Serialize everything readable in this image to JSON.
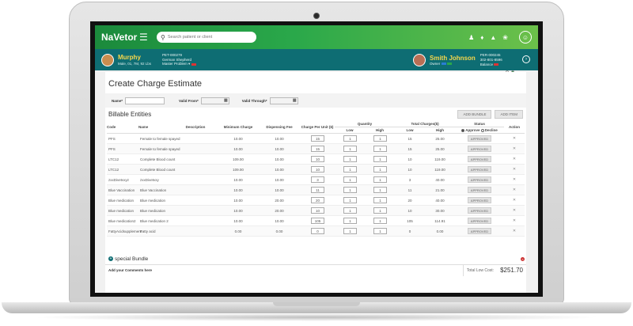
{
  "app": {
    "brand": "NaVetor",
    "search_placeholder": "Search patient or client"
  },
  "patient": {
    "name": "Murphy",
    "meta": "Male, 01, 7M, 92 Lbs",
    "id": "PET-000279",
    "breed": "German Shepherd",
    "problem": "Master Problem ▾"
  },
  "owner": {
    "name": "Smith Johnson",
    "tag": "Owner",
    "id": "PER-000245",
    "phone": "302-801-8596",
    "balance": "Balance"
  },
  "page": {
    "title": "Create Charge Estimate",
    "filters": {
      "name_label": "Name*",
      "valid_from_label": "Valid From*",
      "valid_through_label": "Valid Through*"
    },
    "section_title": "Billable Entities",
    "add_bundle": "ADD BUNDLE",
    "add_item": "ADD ITEM"
  },
  "table": {
    "headers": {
      "code": "Code",
      "name": "Name",
      "description": "Description",
      "min_charge": "Minimum Charge",
      "dispensing_fee": "Dispensing Fee",
      "charge_per_unit": "Charge Per Unit ($)",
      "quantity": "Quantity",
      "low": "Low",
      "high": "High",
      "total_charges": "Total Charges($)",
      "total_low": "Low",
      "total_high": "High",
      "status": "Status",
      "approve": "Approve",
      "decline": "Decline",
      "action": "Action"
    },
    "status_label": "APPROVED",
    "rows": [
      {
        "code": "PFS",
        "name": "",
        "description": "Female to female spayed",
        "min_charge": "10.00",
        "dispensing_fee": "10.00",
        "charge_per_unit": "15",
        "q_low": "1",
        "q_high": "1",
        "t_low": "15",
        "t_high": "25.00"
      },
      {
        "code": "PFS",
        "name": "",
        "description": "Female to female spayed",
        "min_charge": "10.00",
        "dispensing_fee": "10.00",
        "charge_per_unit": "15",
        "q_low": "1",
        "q_high": "1",
        "t_low": "15",
        "t_high": "25.00"
      },
      {
        "code": "LTC12",
        "name": "",
        "description": "Complete Blood count",
        "min_charge": "109.00",
        "dispensing_fee": "10.00",
        "charge_per_unit": "10",
        "q_low": "1",
        "q_high": "1",
        "t_low": "10",
        "t_high": "119.00"
      },
      {
        "code": "LTC12",
        "name": "",
        "description": "Complete Blood count",
        "min_charge": "109.00",
        "dispensing_fee": "10.00",
        "charge_per_unit": "10",
        "q_low": "1",
        "q_high": "1",
        "t_low": "10",
        "t_high": "119.00"
      },
      {
        "code": "zxxDivetvxyz",
        "name": "",
        "description": "zxxDivetvxy",
        "min_charge": "10.00",
        "dispensing_fee": "10.00",
        "charge_per_unit": "3",
        "q_low": "1",
        "q_high": "1",
        "t_low": "3",
        "t_high": "40.00"
      },
      {
        "code": "Blue Vaccination",
        "name": "",
        "description": "Blue Vaccination",
        "min_charge": "10.00",
        "dispensing_fee": "10.00",
        "charge_per_unit": "11",
        "q_low": "1",
        "q_high": "1",
        "t_low": "11",
        "t_high": "21.00"
      },
      {
        "code": "Blue medication",
        "name": "",
        "description": "Blue medication",
        "min_charge": "10.00",
        "dispensing_fee": "20.00",
        "charge_per_unit": "20",
        "q_low": "1",
        "q_high": "1",
        "t_low": "20",
        "t_high": "40.00"
      },
      {
        "code": "Blue medication",
        "name": "",
        "description": "Blue medication",
        "min_charge": "10.00",
        "dispensing_fee": "20.00",
        "charge_per_unit": "10",
        "q_low": "1",
        "q_high": "1",
        "t_low": "10",
        "t_high": "30.00"
      },
      {
        "code": "Blue medication2",
        "name": "",
        "description": "Blue medication 2",
        "min_charge": "10.00",
        "dispensing_fee": "10.00",
        "charge_per_unit": "105",
        "q_low": "1",
        "q_high": "1",
        "t_low": "105",
        "t_high": "114.91"
      },
      {
        "code": "FattyAcidsupplement",
        "name": "",
        "description": "Fatty acid",
        "min_charge": "0.00",
        "dispensing_fee": "0.00",
        "charge_per_unit": "0",
        "q_low": "1",
        "q_high": "1",
        "t_low": "0",
        "t_high": "0.00"
      }
    ]
  },
  "bundle": {
    "name": "special Bundle"
  },
  "footer": {
    "comments_label": "Add your Comments here",
    "total_low_label": "Total Low Cost:",
    "total_low_value": "$251.70"
  },
  "colors": {
    "topbar_start": "#1b8a3c",
    "topbar_end": "#6cc04a",
    "patientbar": "#0e6d73",
    "highlight_name": "#f7d74b"
  }
}
